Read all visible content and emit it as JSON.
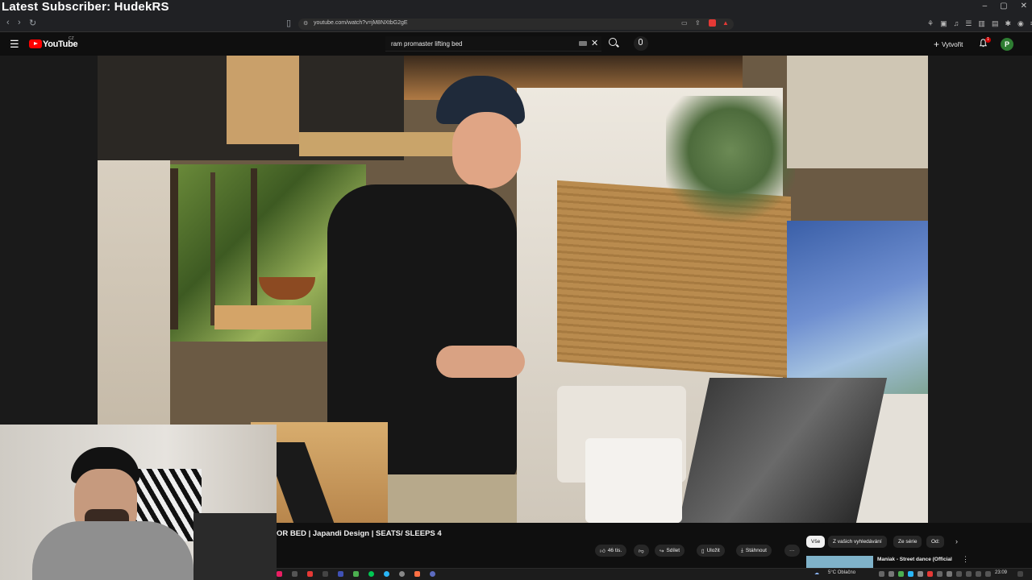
{
  "overlay": {
    "title": "Latest Subscriber: HudekRS"
  },
  "browser": {
    "url": "youtube.com/watch?v=jM8NXtbG2gE",
    "window_controls": [
      "–",
      "▢",
      "✕"
    ]
  },
  "youtube": {
    "logo_text": "YouTube",
    "country_code": "CZ",
    "search": {
      "value": "ram promaster lifting bed"
    },
    "create_label": "Vytvořit",
    "notification_count": "1",
    "avatar_letter": "P"
  },
  "video": {
    "title": "OR BED | Japandi Design | SEATS/ SLEEPS 4"
  },
  "actions": {
    "like_count": "46 tis.",
    "share_label": "Sdílet",
    "save_label": "Uložit",
    "download_label": "Stáhnout",
    "more_label": "···"
  },
  "chips": {
    "all": "Vše",
    "from_searches": "Z vašich vyhledávání",
    "from_series": "Ze série",
    "from": "Od:"
  },
  "recommendation": {
    "title": "Maniak - Street dance (Official"
  },
  "taskbar": {
    "weather": "5°C Oblačno",
    "clock": "23:09"
  },
  "colors": {
    "yt_red": "#ff0000",
    "background": "#0f0f0f",
    "chip_bg": "#272727",
    "avatar_green": "#2e7d32"
  }
}
